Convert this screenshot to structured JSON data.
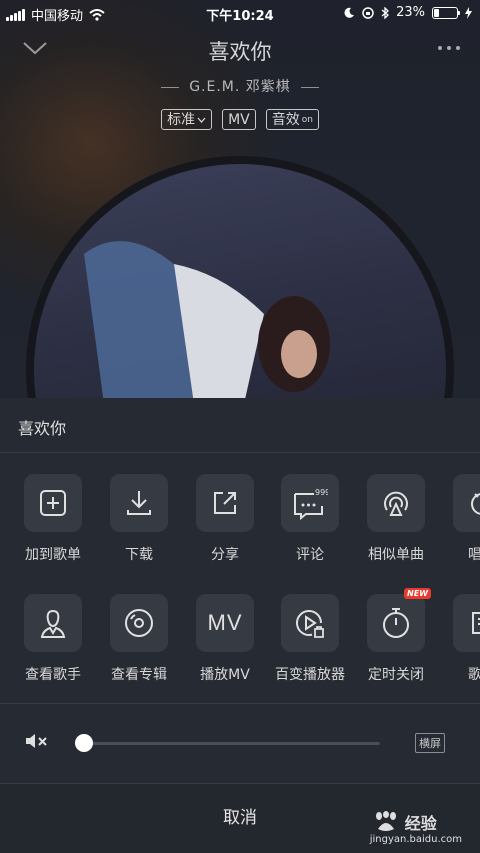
{
  "status_bar": {
    "carrier": "中国移动",
    "time": "下午10:24",
    "battery": "23%",
    "battery_level": 0.23
  },
  "player": {
    "song_title": "喜欢你",
    "artist": "G.E.M. 邓紫棋",
    "quality_chip": "标准",
    "mv_chip": "MV",
    "effect_chip": "音效",
    "effect_state": "on"
  },
  "sheet": {
    "title": "喜欢你",
    "actions_row1": [
      {
        "label": "加到歌单",
        "icon": "add-to-playlist-icon"
      },
      {
        "label": "下载",
        "icon": "download-icon"
      },
      {
        "label": "分享",
        "icon": "share-icon"
      },
      {
        "label": "评论",
        "icon": "comment-icon",
        "count": "999+"
      },
      {
        "label": "相似单曲",
        "icon": "similar-songs-icon"
      },
      {
        "label": "唱这",
        "icon": "sing-icon"
      }
    ],
    "actions_row2": [
      {
        "label": "查看歌手",
        "icon": "artist-icon"
      },
      {
        "label": "查看专辑",
        "icon": "album-icon"
      },
      {
        "label": "播放MV",
        "icon": "mv-icon",
        "glyph": "MV"
      },
      {
        "label": "百变播放器",
        "icon": "player-skin-icon"
      },
      {
        "label": "定时关闭",
        "icon": "timer-icon",
        "badge": "NEW"
      },
      {
        "label": "歌词",
        "icon": "lyrics-icon"
      }
    ],
    "volume": {
      "level": 0.0,
      "landscape_label": "横屏"
    },
    "cancel_label": "取消"
  },
  "watermark": {
    "brand": "经验",
    "url": "jingyan.baidu.com"
  }
}
